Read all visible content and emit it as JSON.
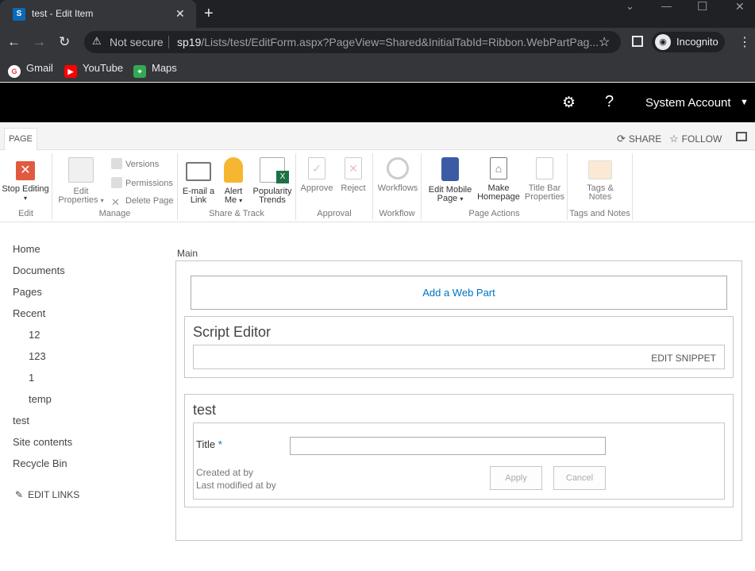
{
  "browser": {
    "tab_title": "test - Edit Item",
    "tab_favicon_text": "S",
    "url_warning": "Not secure",
    "url_host": "sp19",
    "url_path": "/Lists/test/EditForm.aspx?PageView=Shared&InitialTabId=Ribbon.WebPartPag...",
    "profile": "Incognito",
    "bookmarks": [
      {
        "label": "Gmail",
        "icon": "gmail-icon",
        "color": "#ea4335"
      },
      {
        "label": "YouTube",
        "icon": "youtube-icon",
        "color": "#ff0000"
      },
      {
        "label": "Maps",
        "icon": "maps-icon",
        "color": "#34a853"
      }
    ]
  },
  "suite": {
    "user": "System Account"
  },
  "ribbon": {
    "tab": "PAGE",
    "actions": {
      "share": "SHARE",
      "follow": "FOLLOW"
    },
    "groups": {
      "edit": {
        "label": "Edit",
        "stop_editing": "Stop Editing"
      },
      "manage": {
        "label": "Manage",
        "edit_properties_1": "Edit",
        "edit_properties_2": "Properties",
        "versions": "Versions",
        "permissions": "Permissions",
        "delete_page": "Delete Page"
      },
      "share_track": {
        "label": "Share & Track",
        "email_1": "E-mail a",
        "email_2": "Link",
        "alert_1": "Alert",
        "alert_2": "Me",
        "popularity_1": "Popularity",
        "popularity_2": "Trends"
      },
      "approval": {
        "label": "Approval",
        "approve": "Approve",
        "reject": "Reject"
      },
      "workflow": {
        "label": "Workflow",
        "workflows": "Workflows"
      },
      "page_actions": {
        "label": "Page Actions",
        "mobile_1": "Edit Mobile",
        "mobile_2": "Page",
        "homepage_1": "Make",
        "homepage_2": "Homepage",
        "titlebar_1": "Title Bar",
        "titlebar_2": "Properties"
      },
      "tags_notes": {
        "label": "Tags and Notes",
        "tags_1": "Tags &",
        "tags_2": "Notes"
      }
    }
  },
  "nav": {
    "home": "Home",
    "documents": "Documents",
    "pages": "Pages",
    "recent": "Recent",
    "recent_items": [
      "12",
      "123",
      "1",
      "temp"
    ],
    "test": "test",
    "site_contents": "Site contents",
    "recycle_bin": "Recycle Bin",
    "edit_links": "EDIT LINKS"
  },
  "main": {
    "zone_label": "Main",
    "add_web_part": "Add a Web Part",
    "script_editor": {
      "title": "Script Editor",
      "edit_snippet": "EDIT SNIPPET"
    },
    "list_form": {
      "title": "test",
      "field_label": "Title",
      "required_mark": "*",
      "title_value": "",
      "created": "Created at by",
      "modified": "Last modified at by",
      "apply": "Apply",
      "cancel": "Cancel"
    }
  },
  "colors": {
    "sp_blue": "#0072c6",
    "suite_bar": "#000000",
    "stop_red": "#e05a3f"
  }
}
